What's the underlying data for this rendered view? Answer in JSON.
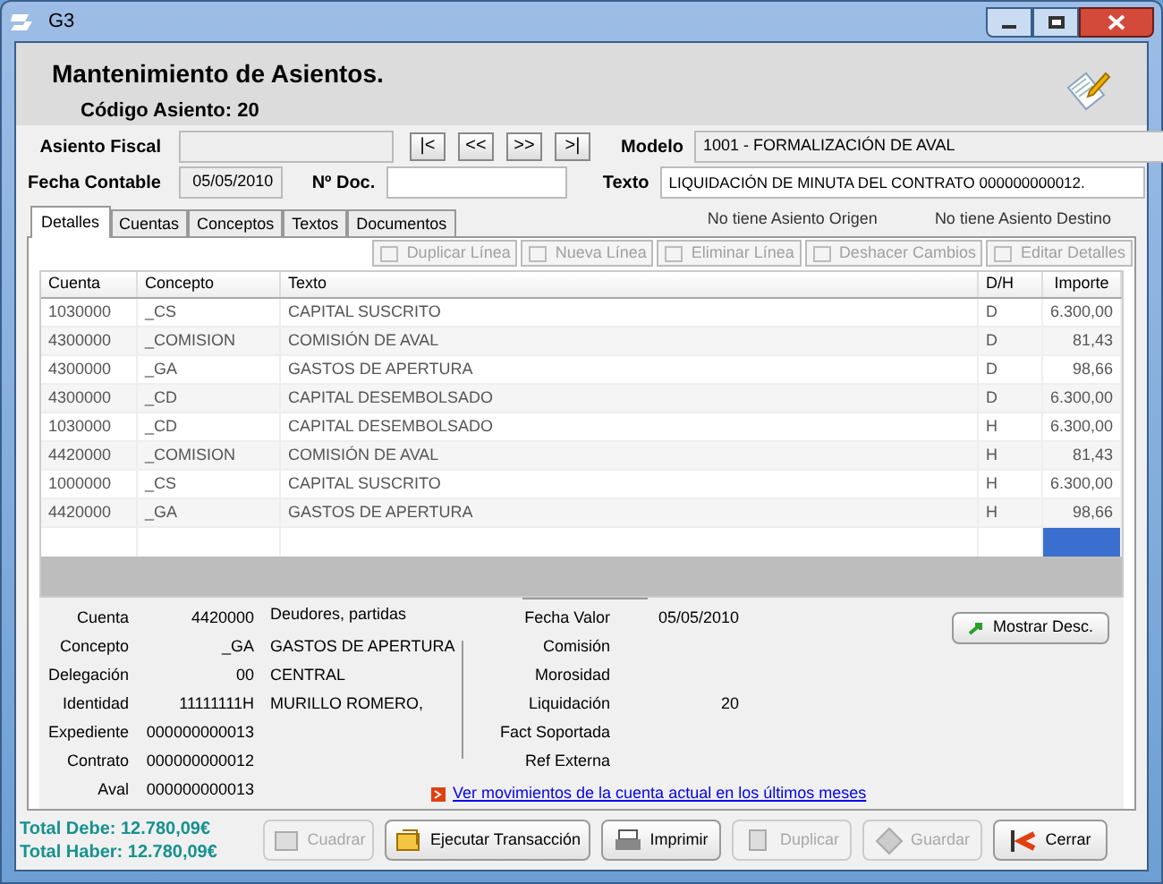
{
  "window": {
    "title": "G3"
  },
  "header": {
    "title": "Mantenimiento de Asientos.",
    "code": "Código Asiento: 20"
  },
  "form": {
    "asiento_fiscal": {
      "label": "Asiento Fiscal"
    },
    "nav_buttons": [
      "|<",
      "<<",
      ">>",
      ">|"
    ],
    "modelo": {
      "label": "Modelo",
      "value": "1001 - FORMALIZACIÓN DE AVAL"
    },
    "fecha_contable": {
      "label": "Fecha Contable",
      "value": "05/05/2010"
    },
    "num_doc": {
      "label": "Nº Doc."
    },
    "texto": {
      "label": "Texto",
      "value": "LIQUIDACIÓN DE MINUTA DEL CONTRATO 000000000012."
    }
  },
  "tabs": [
    {
      "label": "Detalles",
      "selected": true
    },
    {
      "label": "Cuentas",
      "selected": false
    },
    {
      "label": "Conceptos",
      "selected": false
    },
    {
      "label": "Textos",
      "selected": false
    },
    {
      "label": "Documentos",
      "selected": false
    }
  ],
  "origin_note": "No tiene Asiento Origen",
  "destination_note": "No tiene Asiento Destino",
  "toolbar": [
    {
      "label": "Duplicar Línea",
      "disabled": true
    },
    {
      "label": "Nueva Línea",
      "disabled": true
    },
    {
      "label": "Eliminar Línea",
      "disabled": true
    },
    {
      "label": "Deshacer Cambios",
      "disabled": true
    },
    {
      "label": "Editar Detalles",
      "disabled": true
    }
  ],
  "table": {
    "columns": [
      "Cuenta",
      "Concepto",
      "Texto",
      "D/H",
      "Importe"
    ],
    "rows": [
      [
        "1030000",
        "_CS",
        "CAPITAL SUSCRITO",
        "D",
        "6.300,00"
      ],
      [
        "4300000",
        "_COMISION",
        "COMISIÓN DE AVAL",
        "D",
        "81,43"
      ],
      [
        "4300000",
        "_GA",
        "GASTOS DE APERTURA",
        "D",
        "98,66"
      ],
      [
        "4300000",
        "_CD",
        "CAPITAL DESEMBOLSADO",
        "D",
        "6.300,00"
      ],
      [
        "1030000",
        "_CD",
        "CAPITAL DESEMBOLSADO",
        "H",
        "6.300,00"
      ],
      [
        "4420000",
        "_COMISION",
        "COMISIÓN DE AVAL",
        "H",
        "81,43"
      ],
      [
        "1000000",
        "_CS",
        "CAPITAL SUSCRITO",
        "H",
        "6.300,00"
      ],
      [
        "4420000",
        "_GA",
        "GASTOS DE APERTURA",
        "H",
        "98,66"
      ]
    ],
    "new_row": {
      "importe_selected": true
    }
  },
  "details": {
    "left": [
      {
        "label": "Cuenta",
        "value": "4420000"
      },
      {
        "label": "Concepto",
        "value": "_GA"
      },
      {
        "label": "Delegación",
        "value": "00"
      },
      {
        "label": "Identidad",
        "value": "11111111H"
      },
      {
        "label": "Expediente",
        "value": "000000000013"
      },
      {
        "label": "Contrato",
        "value": "000000000012"
      },
      {
        "label": "Aval",
        "value": "000000000013"
      }
    ],
    "descriptions": [
      "Deudores, partidas",
      "GASTOS DE APERTURA",
      "CENTRAL",
      "MURILLO ROMERO,"
    ],
    "right": [
      {
        "label": "Fecha Valor",
        "value": "05/05/2010"
      },
      {
        "label": "Comisión"
      },
      {
        "label": "Morosidad"
      },
      {
        "label": "Liquidación",
        "value": "20"
      },
      {
        "label": "Fact Soportada"
      },
      {
        "label": "Ref Externa"
      }
    ],
    "show_button": "Mostrar Desc.",
    "link": "Ver movimientos de la cuenta actual en los últimos meses"
  },
  "totals": [
    "Total Debe: 12.780,09€",
    "Total Haber: 12.780,09€"
  ],
  "actions": [
    {
      "label": "Cuadrar",
      "disabled": true
    },
    {
      "label": "Ejecutar Transacción",
      "disabled": false
    },
    {
      "label": "Imprimir",
      "disabled": false
    },
    {
      "label": "Duplicar",
      "disabled": true
    },
    {
      "label": "Guardar",
      "disabled": true
    },
    {
      "label": "Cerrar",
      "disabled": false
    }
  ]
}
